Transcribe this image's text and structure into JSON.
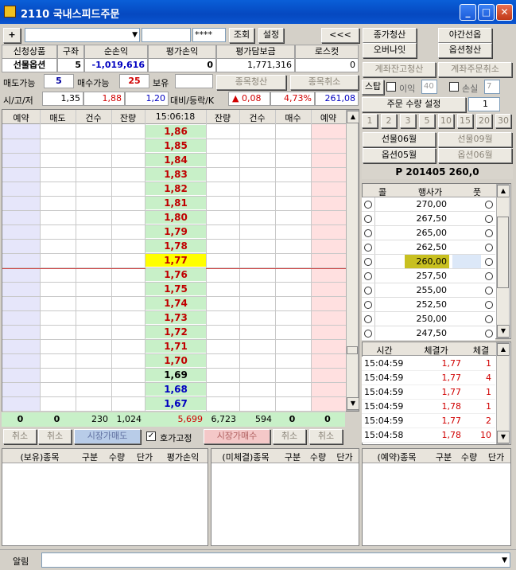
{
  "window": {
    "title": "2110 국내스피드주문",
    "min": "_",
    "max": "□",
    "close": "✕"
  },
  "toolbar": {
    "plus": "+",
    "password": "****",
    "lookup": "조회",
    "settings": "설정",
    "back": "<<<"
  },
  "account": {
    "headers": [
      "신청상품",
      "구좌",
      "순손익",
      "평가손익",
      "평가담보금",
      "로스컷"
    ],
    "values": [
      "선물옵션",
      "5",
      "-1,019,616",
      "0",
      "1,771,316",
      "0"
    ]
  },
  "avail": {
    "sell_label": "매도가능",
    "sell_val": "5",
    "buy_label": "매수가능",
    "buy_val": "25",
    "hold_label": "보유",
    "clear": "종목청산",
    "cancel": "종목취소"
  },
  "ohl": {
    "label": "시/고/저",
    "open": "1,35",
    "high": "1,88",
    "low": "1,20",
    "chg_label": "대비/등락/K",
    "chg": "▲ 0,08",
    "pct": "4,73%",
    "k": "261,08"
  },
  "book": {
    "headers": [
      "예약",
      "매도",
      "건수",
      "잔량",
      "15:06:18",
      "잔량",
      "건수",
      "매수",
      "예약"
    ],
    "prices": [
      "1,86",
      "1,85",
      "1,84",
      "1,83",
      "1,82",
      "1,81",
      "1,80",
      "1,79",
      "1,78",
      "1,77",
      "1,76",
      "1,75",
      "1,74",
      "1,73",
      "1,72",
      "1,71",
      "1,70",
      "1,69",
      "1,68",
      "1,67"
    ],
    "totals": [
      "0",
      "0",
      "230",
      "1,024",
      "5,699",
      "6,723",
      "594",
      "0",
      "0"
    ]
  },
  "bottom_btns": {
    "cancel1": "취소",
    "cancel2": "취소",
    "mkt_sell": "시장가매도",
    "fix": "호가고정",
    "mkt_buy": "시장가매수",
    "cancel3": "취소",
    "cancel4": "취소"
  },
  "right": {
    "b1": "종가청산",
    "b2": "야간선옵",
    "b3": "오버나잇",
    "b4": "옵션청산",
    "b5": "계좌잔고청산",
    "b6": "계좌주문취소",
    "stop": "스탑",
    "profit": "이익",
    "profit_val": "40",
    "loss": "손실",
    "loss_val": "7",
    "qty_label": "주문 수량 설정",
    "qty_val": "1",
    "qty_btns": [
      "1",
      "2",
      "3",
      "5",
      "10",
      "15",
      "20",
      "30"
    ],
    "fut06": "선물06월",
    "fut09": "선물09월",
    "opt05": "옵션05월",
    "opt06": "옵션06월",
    "series": "P 201405 260,0"
  },
  "options": {
    "headers": [
      "콜",
      "행사가",
      "풋"
    ],
    "strikes": [
      "270,00",
      "267,50",
      "265,00",
      "262,50",
      "260,00",
      "257,50",
      "255,00",
      "252,50",
      "250,00",
      "247,50"
    ]
  },
  "trades": {
    "headers": [
      "시간",
      "체결가",
      "체결"
    ],
    "rows": [
      [
        "15:04:59",
        "1,77",
        "1"
      ],
      [
        "15:04:59",
        "1,77",
        "4"
      ],
      [
        "15:04:59",
        "1,77",
        "1"
      ],
      [
        "15:04:59",
        "1,78",
        "1"
      ],
      [
        "15:04:59",
        "1,77",
        "2"
      ],
      [
        "15:04:58",
        "1,78",
        "10"
      ]
    ]
  },
  "lists": {
    "hold": [
      "(보유)종목",
      "구분",
      "수량",
      "단가",
      "평가손익"
    ],
    "open": [
      "(미체결)종목",
      "구분",
      "수량",
      "단가"
    ],
    "reserve": [
      "(예약)종목",
      "구분",
      "수량",
      "단가"
    ]
  },
  "status": {
    "label": "알림"
  }
}
